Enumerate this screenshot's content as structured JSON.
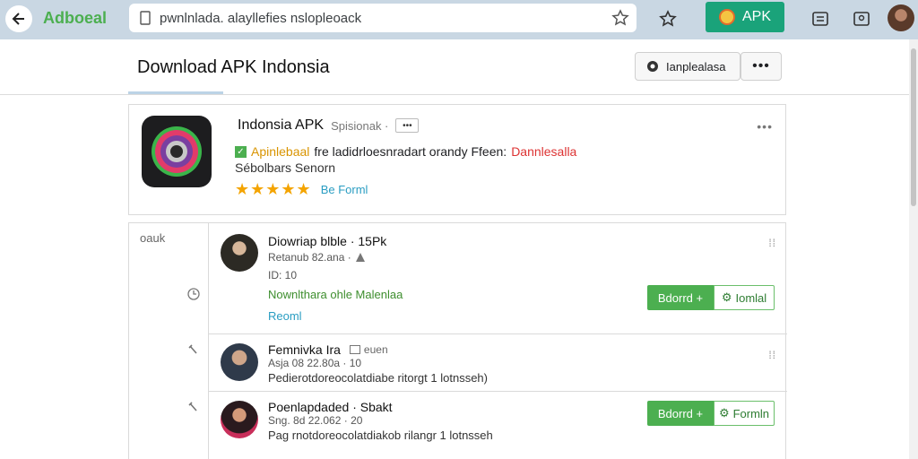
{
  "browser": {
    "brand": "Adboeal",
    "url": "pwnlnlada. alayllefies nslopleoack",
    "apk_button_label": "APK"
  },
  "header": {
    "title": "Download APK Indonsia",
    "menu_label": "Ianplealasa",
    "more_label": "•••"
  },
  "app": {
    "name": "Indonsia APK",
    "name_sub": "Spisionak ·",
    "chip": "•••",
    "desc_highlight": "Apinlebaal",
    "desc_text": "fre ladidrloesnradart orandy Ffeen:",
    "desc_red": "Dannlesalla",
    "size_text": "Sébolbars Senorn",
    "stars": "★★★★★",
    "rating_text": "Be Forml",
    "more": "•••"
  },
  "sidebar": {
    "label": "oauk"
  },
  "items": [
    {
      "title": "Diowriap blble · 15Pk",
      "meta": "Retanub 82.ana ·",
      "meta2": "ID: 10",
      "line1": "Nownlthara ohle Malenlaa",
      "line2": "Reoml",
      "btn_primary": "Bdorrd +",
      "btn_secondary": "Iomlal"
    },
    {
      "title": "Femnivka Ira",
      "title_tag": "euen",
      "meta": "Asja 08 22.80a · 10",
      "line1": "Pedierotdoreocolatdiabe ritorgt 1 lotnsseh)"
    },
    {
      "title": "Poenlapdaded · Sbakt",
      "meta": "Sng. 8d 22.062 · 20",
      "line1": "Pag rnotdoreocolatdiakob rilangr 1 lotnsseh",
      "btn_primary": "Bdorrd +",
      "btn_secondary": "Formln"
    }
  ]
}
